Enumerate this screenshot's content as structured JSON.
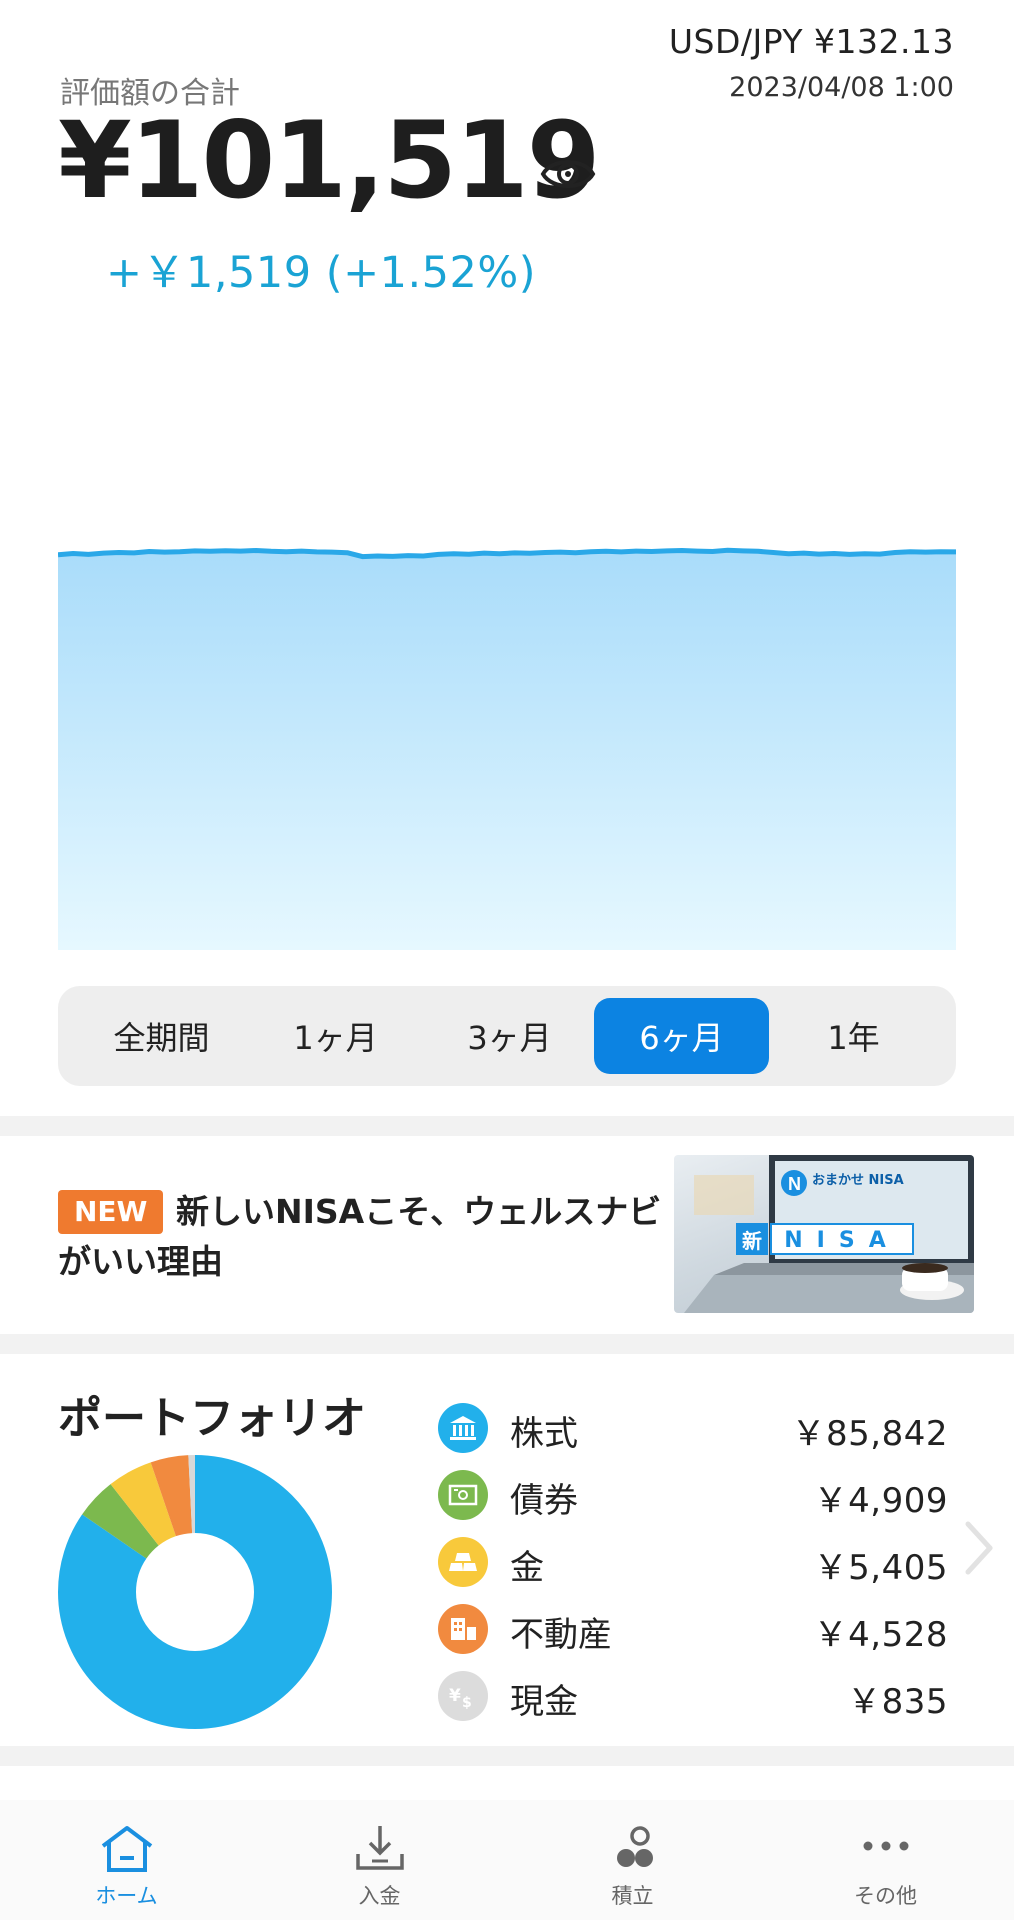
{
  "header": {
    "exchange_rate": "USD/JPY ¥132.13",
    "timestamp": "2023/04/08 1:00",
    "total_label": "評価額の合計",
    "total_value": "¥101,519",
    "change": "+￥1,519 (+1.52%)"
  },
  "chart_data": {
    "type": "area",
    "title": "",
    "xlabel": "",
    "ylabel": "",
    "ylim": [
      0,
      105000
    ],
    "x": [
      1,
      2,
      3,
      4,
      5,
      6,
      7,
      8,
      9,
      10,
      11,
      12,
      13,
      14,
      15,
      16,
      17,
      18,
      19,
      20,
      21,
      22,
      23,
      24,
      25,
      26,
      27,
      28,
      29,
      30,
      31,
      32,
      33,
      34,
      35,
      36,
      37,
      38,
      39,
      40,
      41,
      42,
      43,
      44,
      45,
      46,
      47,
      48,
      49,
      50,
      51,
      52,
      53,
      54,
      55,
      56,
      57,
      58,
      59,
      60
    ],
    "series": [
      {
        "color": "#2aa8e8",
        "values": [
          101200,
          101550,
          101300,
          101650,
          101800,
          101700,
          102050,
          101900,
          102000,
          102200,
          102100,
          102250,
          102150,
          102300,
          102100,
          102000,
          102150,
          101950,
          101900,
          101750,
          100750,
          100900,
          100800,
          101000,
          100900,
          101300,
          101500,
          101350,
          101650,
          101500,
          101700,
          101600,
          101800,
          101900,
          101750,
          102000,
          102100,
          101950,
          102150,
          102050,
          102200,
          102300,
          102150,
          102050,
          102350,
          102200,
          102100,
          101800,
          101500,
          101650,
          101400,
          101550,
          101300,
          101500,
          101400,
          101800,
          102000,
          101900,
          102000,
          101950
        ]
      }
    ]
  },
  "periods": {
    "items": [
      "全期間",
      "1ヶ月",
      "3ヶ月",
      "6ヶ月",
      "1年"
    ],
    "active_index": 3
  },
  "banner": {
    "badge": "NEW",
    "title_line1": "新しいNISAこそ、ウェルスナビ",
    "title_line2": "がいい理由",
    "image_brand": "おまかせ NISA",
    "image_caption_new": "新",
    "image_caption_nisa": "NISA"
  },
  "portfolio": {
    "title": "ポートフォリオ",
    "assets": [
      {
        "name": "株式",
        "value": "￥85,842",
        "amount": 85842,
        "color": "#22b0eb",
        "icon": "bank-icon"
      },
      {
        "name": "債券",
        "value": "￥4,909",
        "amount": 4909,
        "color": "#7cb94e",
        "icon": "bond-icon"
      },
      {
        "name": "金",
        "value": "￥5,405",
        "amount": 5405,
        "color": "#f8c93b",
        "icon": "gold-icon"
      },
      {
        "name": "不動産",
        "value": "￥4,528",
        "amount": 4528,
        "color": "#f18a3f",
        "icon": "building-icon"
      },
      {
        "name": "現金",
        "value": "￥835",
        "amount": 835,
        "color": "#d8d8d8",
        "icon": "cash-icon"
      }
    ]
  },
  "bottom_nav": {
    "items": [
      {
        "label": "ホーム",
        "icon": "home-icon",
        "active": true
      },
      {
        "label": "入金",
        "icon": "deposit-icon",
        "active": false
      },
      {
        "label": "積立",
        "icon": "accumulate-icon",
        "active": false
      },
      {
        "label": "その他",
        "icon": "more-icon",
        "active": false
      }
    ],
    "active_color": "#1a8fe0"
  }
}
